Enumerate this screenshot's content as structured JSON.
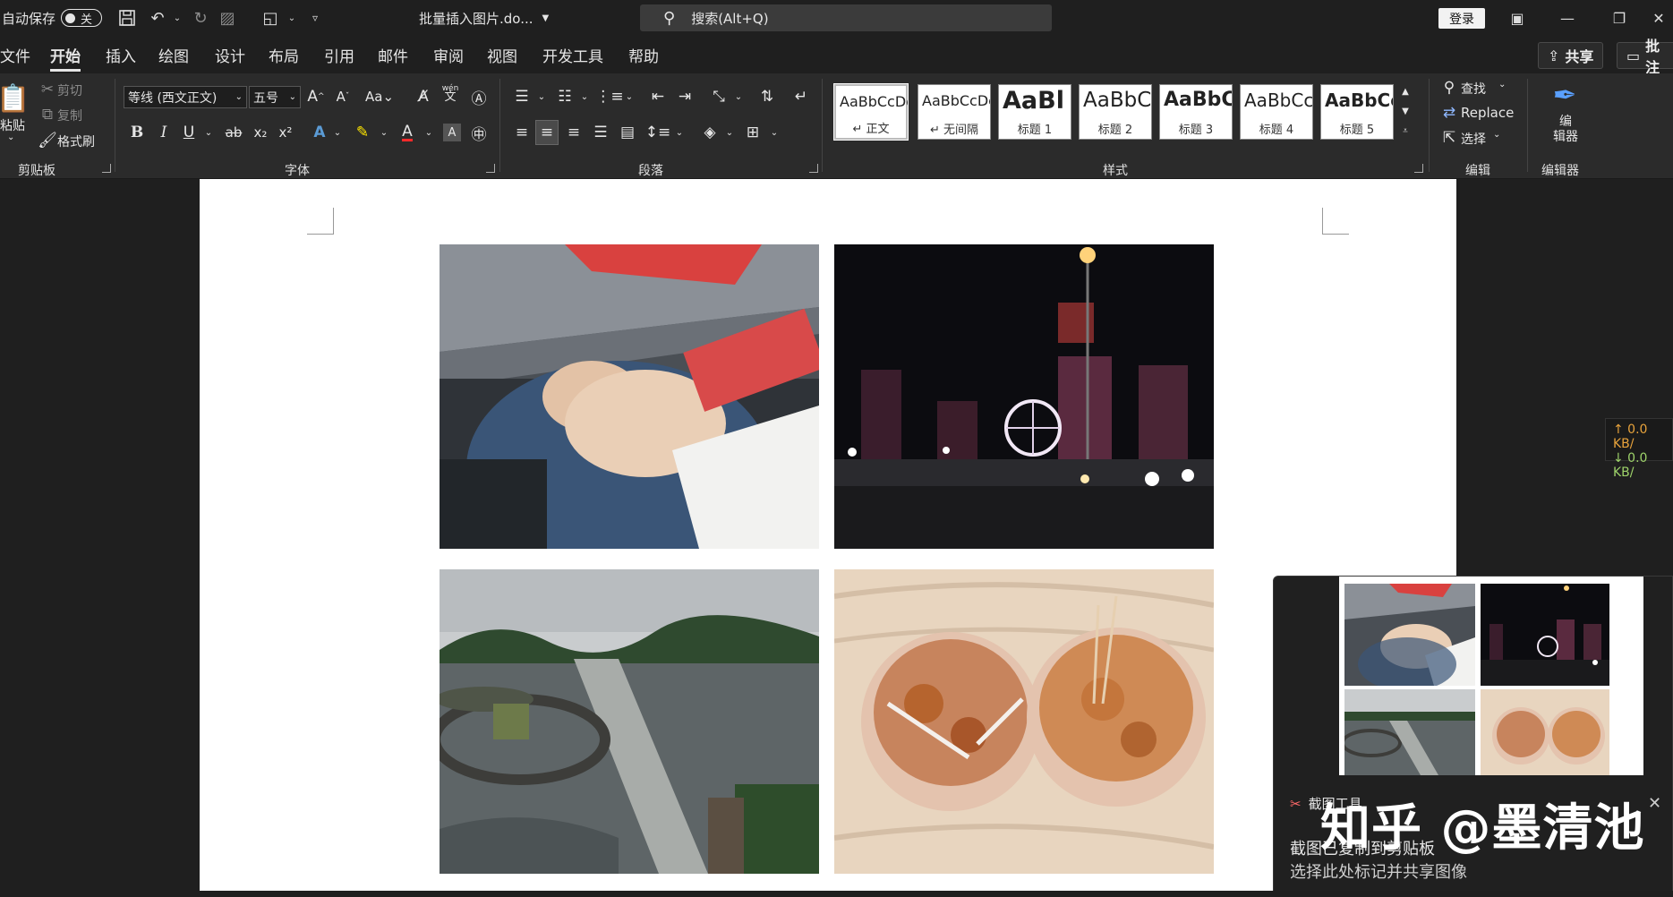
{
  "titlebar": {
    "autosave_label": "自动保存",
    "autosave_state": "关",
    "doc_title": "批量插入图片.do...",
    "search_placeholder": "搜索(Alt+Q)",
    "login": "登录"
  },
  "menu": {
    "tabs": [
      "文件",
      "开始",
      "插入",
      "绘图",
      "设计",
      "布局",
      "引用",
      "邮件",
      "审阅",
      "视图",
      "开发工具",
      "帮助"
    ],
    "active_tab": "开始",
    "share": "共享",
    "comment": "批注"
  },
  "ribbon": {
    "clipboard": {
      "paste": "粘贴",
      "cut": "剪切",
      "copy": "复制",
      "format_painter": "格式刷",
      "label": "剪贴板"
    },
    "font": {
      "font_name": "等线 (西文正文)",
      "font_size": "五号",
      "label": "字体",
      "wen": "wén",
      "wen2": "文"
    },
    "paragraph": {
      "label": "段落"
    },
    "styles": {
      "label": "样式",
      "items": [
        {
          "preview": "AaBbCcDc",
          "name": "↵ 正文"
        },
        {
          "preview": "AaBbCcDc",
          "name": "↵ 无间隔"
        },
        {
          "preview": "AaBl",
          "name": "标题 1"
        },
        {
          "preview": "AaBbC",
          "name": "标题 2"
        },
        {
          "preview": "AaBbC",
          "name": "标题 3"
        },
        {
          "preview": "AaBbCc",
          "name": "标题 4"
        },
        {
          "preview": "AaBbCc",
          "name": "标题 5"
        }
      ]
    },
    "editing": {
      "find": "查找",
      "replace": "Replace",
      "select": "选择",
      "label": "编辑"
    },
    "editor": {
      "btn": "编\n辑器",
      "label": "编辑器"
    }
  },
  "netspeed": {
    "up": "↑ 0.0 KB/",
    "down": "↓ 0.0 KB/"
  },
  "toast": {
    "app": "截图工具",
    "title": "截图已复制到剪贴板",
    "subtitle": "选择此处标记并共享图像"
  },
  "watermark": "知乎 @墨清池",
  "colors": {
    "accent": "#e6e6e6",
    "ribbon_bg": "#2b2b2b",
    "titlebar_bg": "#1f1f1f"
  }
}
